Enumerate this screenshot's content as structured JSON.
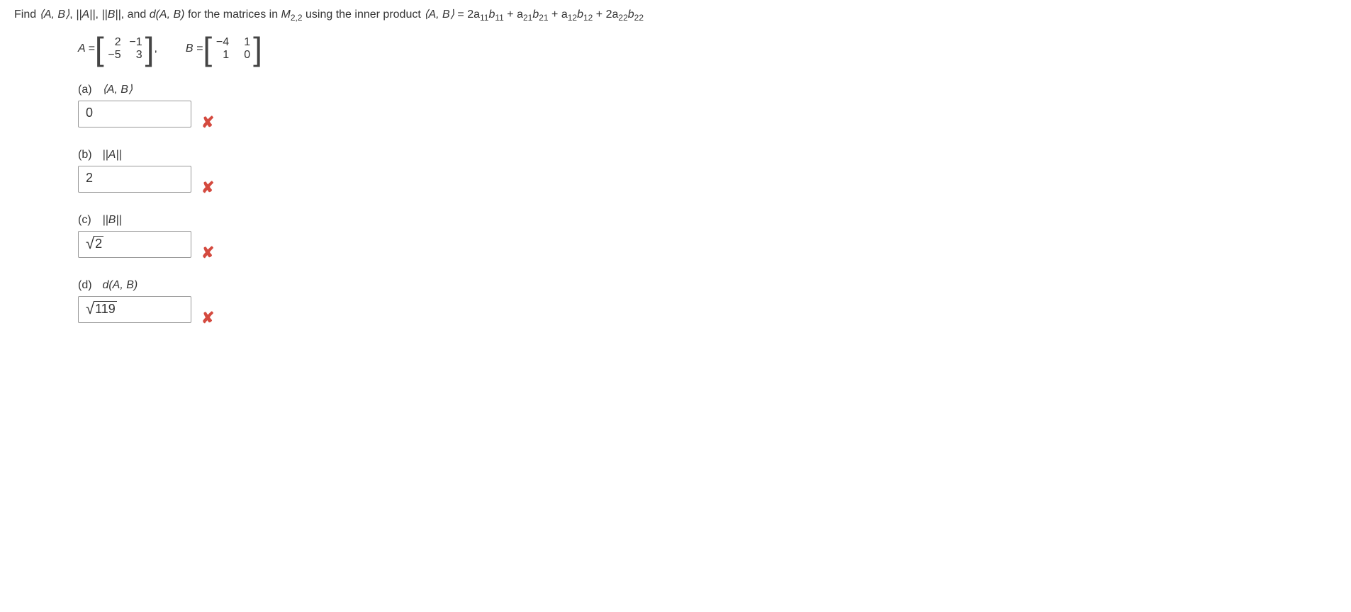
{
  "question": {
    "prefix": "Find ",
    "ab": "⟨A, B⟩",
    "normA": "||A||",
    "normB": "||B||",
    "andtxt": ", and ",
    "dAB": "d(A, B)",
    "midtxt": " for the matrices in ",
    "space": "M",
    "spacesub": "2,2",
    "usingtxt": " using the inner product ",
    "eqtxt": " = 2a",
    "t11a": "11",
    "b": "b",
    "t11b": "11",
    "plus1": " + a",
    "t21a": "21",
    "t21b": "21",
    "plus2": " + a",
    "t12a": "12",
    "t12b": "12",
    "plus3": " + 2a",
    "t22a": "22",
    "t22b": "22"
  },
  "matrices": {
    "Aeq": "A = ",
    "A": {
      "r1c1": "2",
      "r1c2": "−1",
      "r2c1": "−5",
      "r2c2": "3"
    },
    "comma": ",",
    "Beq": "B = ",
    "B": {
      "r1c1": "−4",
      "r1c2": "1",
      "r2c1": "1",
      "r2c2": "0"
    }
  },
  "parts": {
    "a": {
      "label": "(a)",
      "expr": "⟨A, B⟩",
      "answer": "0",
      "status": "incorrect"
    },
    "b": {
      "label": "(b)",
      "expr": "||A||",
      "answer": "2",
      "status": "incorrect"
    },
    "c": {
      "label": "(c)",
      "expr": "||B||",
      "answer_sqrt": "2",
      "status": "incorrect"
    },
    "d": {
      "label": "(d)",
      "expr": "d(A, B)",
      "answer_sqrt": "119",
      "status": "incorrect"
    }
  },
  "icons": {
    "incorrect_glyph": "✘"
  }
}
